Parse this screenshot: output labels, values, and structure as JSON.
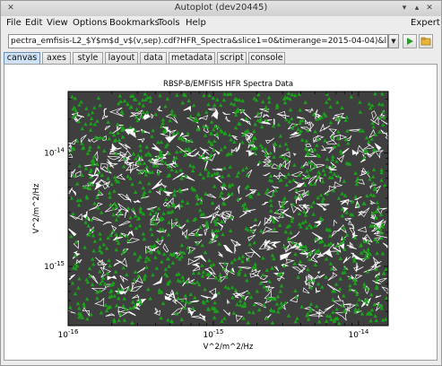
{
  "window": {
    "title": "Autoplot (dev20445)"
  },
  "menu": [
    "File",
    "Edit",
    "View",
    "Options",
    "Bookmarks",
    "Tools",
    "Help"
  ],
  "menu_right": "Expert",
  "toolbar": {
    "url": "pectra_emfisis-L2_$Y$m$d_v$(v,sep).cdf?HFR_Spectra&slice1=0&timerange=2015-04-04)&link(ds1,d",
    "dropdown_icon": "chevron-down-icon",
    "run_icon": "play-icon",
    "browse_icon": "folder-icon"
  },
  "tabs": [
    "canvas",
    "axes",
    "style",
    "layout",
    "data",
    "metadata",
    "script",
    "console"
  ],
  "active_tab": "canvas",
  "colors": {
    "plot_bg": "#3f3f3f",
    "points": "#1aa31a",
    "links": "#ffffff",
    "tab_active": "#cfe1f5"
  },
  "chart_data": {
    "type": "scatter",
    "title": "RBSP-B/EMFISIS  HFR Spectra Data",
    "xlabel": "V^2/m^2/Hz",
    "ylabel": "V^2/m^2/Hz",
    "xscale": "log",
    "yscale": "log",
    "xlim": [
      1e-16,
      1.6e-14
    ],
    "ylim": [
      3e-16,
      3.5e-14
    ],
    "x_ticks": [
      "10^-16",
      "10^-15",
      "10^-14"
    ],
    "x_tick_values": [
      1e-16,
      1e-15,
      1e-14
    ],
    "y_ticks": [
      "10^-15",
      "10^-14"
    ],
    "y_tick_values": [
      1e-15,
      1e-14
    ],
    "series": [
      {
        "marker": "triangle",
        "color": "#1aa31a",
        "point_count": 1200
      }
    ],
    "overlay": "white polygon network linking points"
  }
}
